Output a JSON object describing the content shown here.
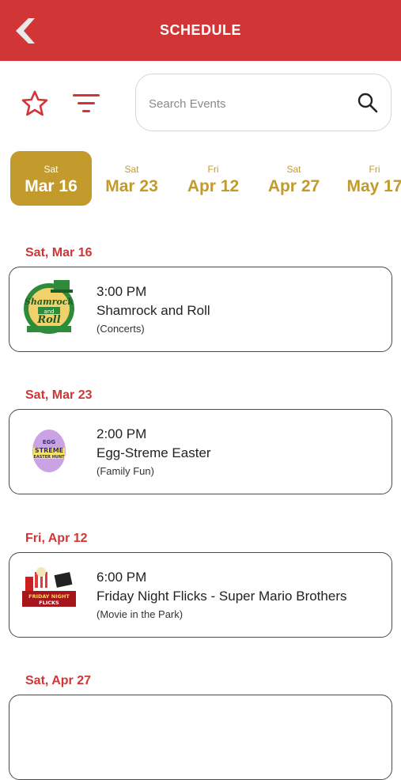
{
  "header": {
    "title": "SCHEDULE"
  },
  "search": {
    "placeholder": "Search Events"
  },
  "date_tabs": [
    {
      "dow": "Sat",
      "date": "Mar 16",
      "active": true
    },
    {
      "dow": "Sat",
      "date": "Mar 23",
      "active": false
    },
    {
      "dow": "Fri",
      "date": "Apr 12",
      "active": false
    },
    {
      "dow": "Sat",
      "date": "Apr 27",
      "active": false
    },
    {
      "dow": "Fri",
      "date": "May 17",
      "active": false
    }
  ],
  "events": [
    {
      "day": "Sat, Mar 16",
      "time": "3:00 PM",
      "name": "Shamrock and Roll",
      "category": "(Concerts)",
      "logo_text": [
        "Shamrock",
        "and",
        "Roll"
      ]
    },
    {
      "day": "Sat, Mar 23",
      "time": "2:00 PM",
      "name": "Egg-Streme Easter",
      "category": "(Family Fun)",
      "logo_text": [
        "EGG",
        "STREME",
        "EASTER HUNT"
      ]
    },
    {
      "day": "Fri, Apr 12",
      "time": "6:00 PM",
      "name": "Friday Night Flicks - Super Mario Brothers",
      "category": "(Movie in the Park)",
      "logo_text": [
        "FRIDAY NIGHT",
        "FLICKS"
      ]
    },
    {
      "day": "Sat, Apr 27"
    }
  ],
  "colors": {
    "header_red": "#d13535",
    "gold": "#c29b2c",
    "card_border": "#4a4a4a"
  }
}
